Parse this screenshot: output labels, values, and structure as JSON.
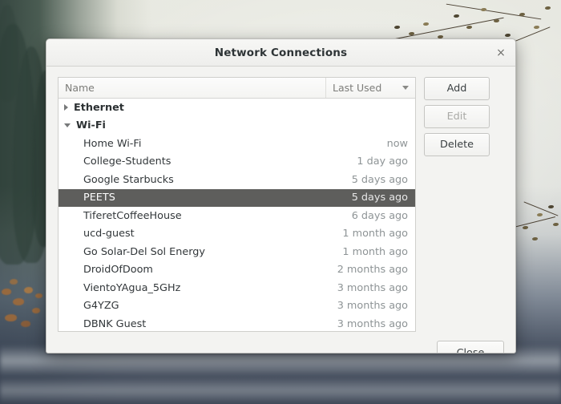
{
  "window": {
    "title": "Network Connections",
    "close_icon": "close-icon",
    "close_label": "×"
  },
  "list": {
    "columns": [
      {
        "key": "name",
        "label": "Name"
      },
      {
        "key": "last_used",
        "label": "Last Used",
        "sort_icon": "chevron-down-icon",
        "sorted": true
      }
    ],
    "groups": [
      {
        "label": "Ethernet",
        "expanded": false,
        "expander_icon": "triangle-right-icon",
        "items": []
      },
      {
        "label": "Wi-Fi",
        "expanded": true,
        "expander_icon": "triangle-down-icon",
        "items": [
          {
            "name": "Home Wi-Fi",
            "last_used": "now",
            "selected": false
          },
          {
            "name": "College-Students",
            "last_used": "1 day ago",
            "selected": false
          },
          {
            "name": "Google Starbucks",
            "last_used": "5 days ago",
            "selected": false
          },
          {
            "name": "PEETS",
            "last_used": "5 days ago",
            "selected": true
          },
          {
            "name": "TiferetCoffeeHouse",
            "last_used": "6 days ago",
            "selected": false
          },
          {
            "name": "ucd-guest",
            "last_used": "1 month ago",
            "selected": false
          },
          {
            "name": "Go Solar-Del Sol Energy",
            "last_used": "1 month ago",
            "selected": false
          },
          {
            "name": "DroidOfDoom",
            "last_used": "2 months ago",
            "selected": false
          },
          {
            "name": "VientoYAgua_5GHz",
            "last_used": "3 months ago",
            "selected": false
          },
          {
            "name": "G4YZG",
            "last_used": "3 months ago",
            "selected": false
          },
          {
            "name": "DBNK Guest",
            "last_used": "3 months ago",
            "selected": false
          }
        ]
      }
    ]
  },
  "buttons": {
    "add": "Add",
    "edit": "Edit",
    "delete": "Delete",
    "close": "Close"
  },
  "colors": {
    "selection": "#5e5e5c",
    "dialog_bg": "#f3f3f1",
    "list_bg": "#ffffff",
    "muted_text": "#8e9496"
  }
}
